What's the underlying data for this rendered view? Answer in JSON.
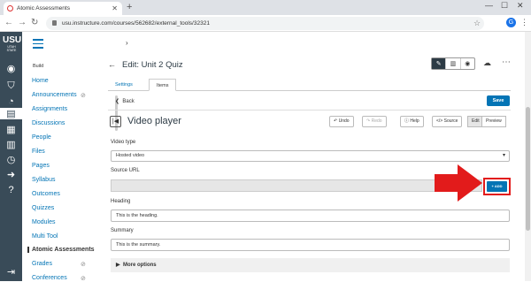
{
  "browser": {
    "tab_title": "Atomic Assessments",
    "url": "usu.instructure.com/courses/562682/external_tools/32321",
    "profile_initial": "G"
  },
  "logo": {
    "text": "USU",
    "sub": "UTAH STATE"
  },
  "course_nav": {
    "section": "Build",
    "items": [
      {
        "label": "Home",
        "hidden": false
      },
      {
        "label": "Announcements",
        "hidden": true
      },
      {
        "label": "Assignments",
        "hidden": false
      },
      {
        "label": "Discussions",
        "hidden": false
      },
      {
        "label": "People",
        "hidden": false
      },
      {
        "label": "Files",
        "hidden": false
      },
      {
        "label": "Pages",
        "hidden": false
      },
      {
        "label": "Syllabus",
        "hidden": false
      },
      {
        "label": "Outcomes",
        "hidden": false
      },
      {
        "label": "Quizzes",
        "hidden": false
      },
      {
        "label": "Modules",
        "hidden": false
      },
      {
        "label": "Multi Tool",
        "hidden": false
      },
      {
        "label": "Atomic Assessments",
        "hidden": false,
        "active": true
      },
      {
        "label": "Grades",
        "hidden": true
      },
      {
        "label": "Conferences",
        "hidden": true
      }
    ]
  },
  "header": {
    "title": "Edit: Unit 2 Quiz"
  },
  "tabs": {
    "settings": "Settings",
    "items": "Items"
  },
  "toolbar": {
    "back": "Back",
    "save": "Save"
  },
  "widget": {
    "title": "Video player",
    "undo": "Undo",
    "redo": "Redo",
    "help": "Help",
    "source": "Source",
    "edit": "Edit",
    "preview": "Preview"
  },
  "form": {
    "video_type_label": "Video type",
    "video_type_value": "Hosted video",
    "source_url_label": "Source URL",
    "add_button": "+ ADD",
    "heading_label": "Heading",
    "heading_value": "This is the heading.",
    "summary_label": "Summary",
    "summary_value": "This is the summary.",
    "more_options": "More options"
  },
  "colors": {
    "canvas_nav": "#394b58",
    "link": "#0374b5",
    "highlight": "#e21b1b"
  }
}
